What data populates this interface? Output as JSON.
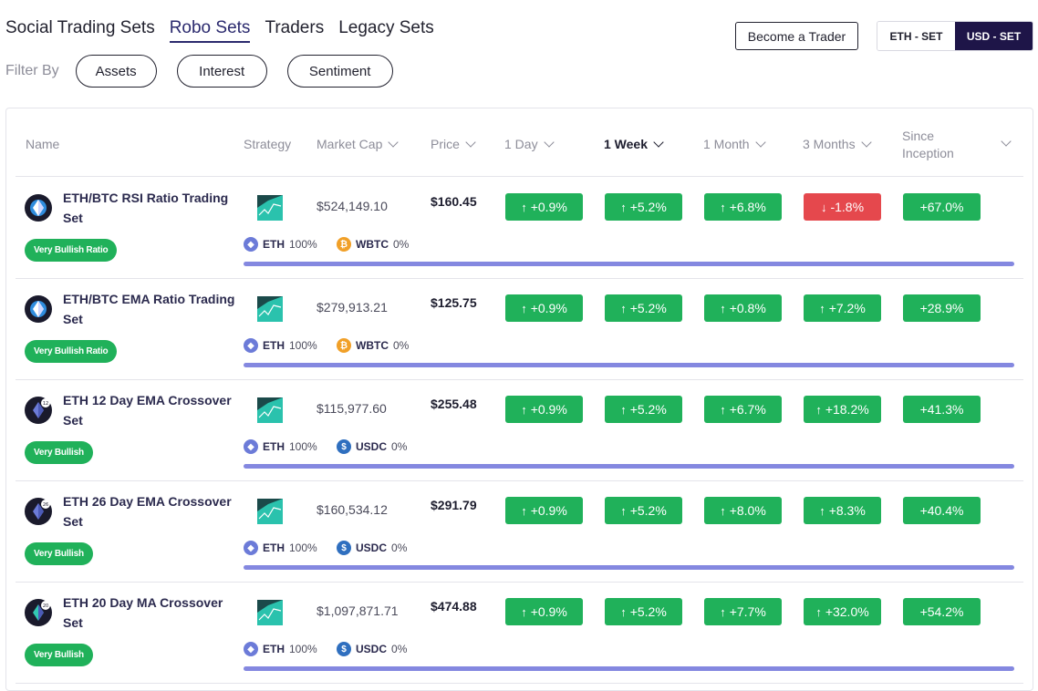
{
  "nav": {
    "tabs": [
      {
        "label": "Social Trading Sets",
        "active": false
      },
      {
        "label": "Robo Sets",
        "active": true
      },
      {
        "label": "Traders",
        "active": false
      },
      {
        "label": "Legacy Sets",
        "active": false
      }
    ]
  },
  "filter": {
    "label": "Filter By",
    "options": [
      "Assets",
      "Interest",
      "Sentiment"
    ]
  },
  "become_trader_label": "Become a Trader",
  "currency_toggle": {
    "options": [
      "ETH - SET",
      "USD - SET"
    ],
    "selected": "USD - SET"
  },
  "table": {
    "columns": {
      "name": "Name",
      "strategy": "Strategy",
      "market_cap": "Market Cap",
      "price": "Price",
      "day": "1 Day",
      "week": "1 Week",
      "month": "1 Month",
      "three_months": "3 Months",
      "inception": "Since Inception"
    },
    "rows": [
      {
        "name": "ETH/BTC RSI Ratio Trading Set",
        "sentiment": "Very Bullish Ratio",
        "icon": "ethbtc-coin-icon",
        "market_cap": "$524,149.10",
        "price": "$160.45",
        "changes": [
          {
            "value": "+0.9%",
            "dir": "up"
          },
          {
            "value": "+5.2%",
            "dir": "up"
          },
          {
            "value": "+6.8%",
            "dir": "up"
          },
          {
            "value": "-1.8%",
            "dir": "down"
          },
          {
            "value": "+67.0%",
            "dir": "none"
          }
        ],
        "alloc": [
          {
            "token": "ETH",
            "pct": "100%",
            "kind": "eth"
          },
          {
            "token": "WBTC",
            "pct": "0%",
            "kind": "wbtc"
          }
        ]
      },
      {
        "name": "ETH/BTC EMA Ratio Trading Set",
        "sentiment": "Very Bullish Ratio",
        "icon": "ethbtc-coin-icon",
        "market_cap": "$279,913.21",
        "price": "$125.75",
        "changes": [
          {
            "value": "+0.9%",
            "dir": "up"
          },
          {
            "value": "+5.2%",
            "dir": "up"
          },
          {
            "value": "+0.8%",
            "dir": "up"
          },
          {
            "value": "+7.2%",
            "dir": "up"
          },
          {
            "value": "+28.9%",
            "dir": "none"
          }
        ],
        "alloc": [
          {
            "token": "ETH",
            "pct": "100%",
            "kind": "eth"
          },
          {
            "token": "WBTC",
            "pct": "0%",
            "kind": "wbtc"
          }
        ]
      },
      {
        "name": "ETH 12 Day EMA Crossover Set",
        "sentiment": "Very Bullish",
        "icon": "eth-12-coin-icon",
        "market_cap": "$115,977.60",
        "price": "$255.48",
        "changes": [
          {
            "value": "+0.9%",
            "dir": "up"
          },
          {
            "value": "+5.2%",
            "dir": "up"
          },
          {
            "value": "+6.7%",
            "dir": "up"
          },
          {
            "value": "+18.2%",
            "dir": "up"
          },
          {
            "value": "+41.3%",
            "dir": "none"
          }
        ],
        "alloc": [
          {
            "token": "ETH",
            "pct": "100%",
            "kind": "eth"
          },
          {
            "token": "USDC",
            "pct": "0%",
            "kind": "usdc"
          }
        ]
      },
      {
        "name": "ETH 26 Day EMA Crossover Set",
        "sentiment": "Very Bullish",
        "icon": "eth-26-coin-icon",
        "market_cap": "$160,534.12",
        "price": "$291.79",
        "changes": [
          {
            "value": "+0.9%",
            "dir": "up"
          },
          {
            "value": "+5.2%",
            "dir": "up"
          },
          {
            "value": "+8.0%",
            "dir": "up"
          },
          {
            "value": "+8.3%",
            "dir": "up"
          },
          {
            "value": "+40.4%",
            "dir": "none"
          }
        ],
        "alloc": [
          {
            "token": "ETH",
            "pct": "100%",
            "kind": "eth"
          },
          {
            "token": "USDC",
            "pct": "0%",
            "kind": "usdc"
          }
        ]
      },
      {
        "name": "ETH 20 Day MA Crossover Set",
        "sentiment": "Very Bullish",
        "icon": "eth-20-coin-icon",
        "market_cap": "$1,097,871.71",
        "price": "$474.88",
        "changes": [
          {
            "value": "+0.9%",
            "dir": "up"
          },
          {
            "value": "+5.2%",
            "dir": "up"
          },
          {
            "value": "+7.7%",
            "dir": "up"
          },
          {
            "value": "+32.0%",
            "dir": "up"
          },
          {
            "value": "+54.2%",
            "dir": "none"
          }
        ],
        "alloc": [
          {
            "token": "ETH",
            "pct": "100%",
            "kind": "eth"
          },
          {
            "token": "USDC",
            "pct": "0%",
            "kind": "usdc"
          }
        ]
      }
    ]
  },
  "colors": {
    "up": "#20b15a",
    "down": "#e5484d",
    "accent": "#1e1548",
    "bar": "#8488e0"
  }
}
